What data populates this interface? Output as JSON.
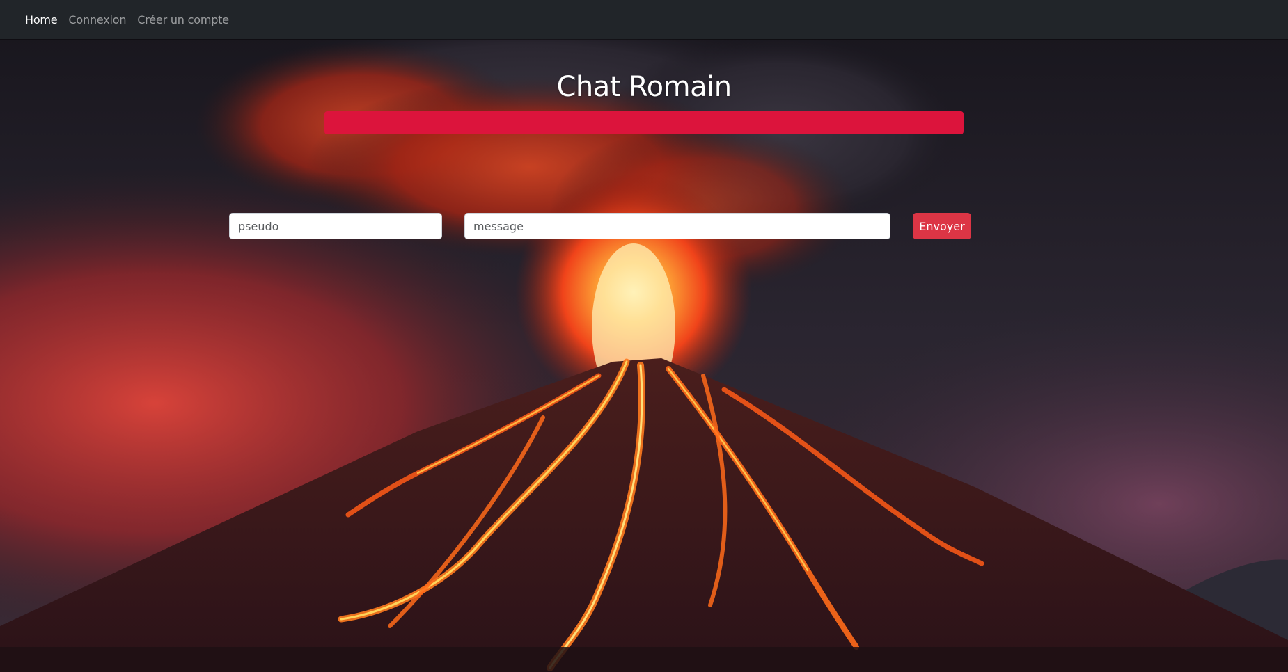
{
  "navbar": {
    "links": [
      {
        "label": "Home",
        "active": true
      },
      {
        "label": "Connexion",
        "active": false
      },
      {
        "label": "Créer un compte",
        "active": false
      }
    ]
  },
  "main": {
    "title": "Chat Romain",
    "chat_box_color": "#dc143c"
  },
  "form": {
    "pseudo_placeholder": "pseudo",
    "message_placeholder": "message",
    "send_label": "Envoyer",
    "send_color": "#dc3545"
  },
  "background": {
    "image": "volcano-eruption-icon"
  }
}
